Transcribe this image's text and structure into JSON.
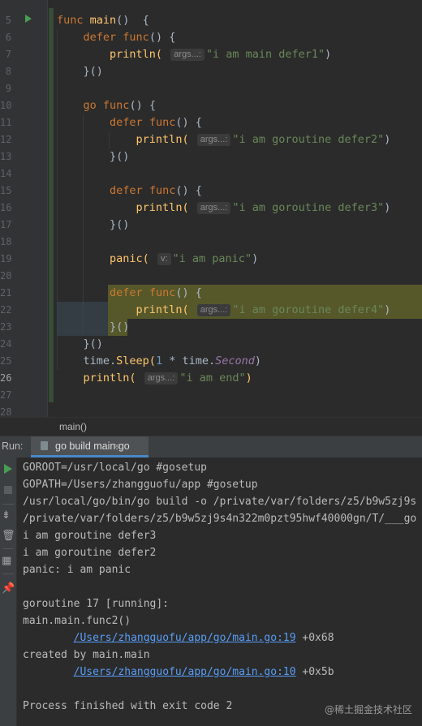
{
  "editor": {
    "line_numbers": [
      "5",
      "6",
      "7",
      "8",
      "9",
      "10",
      "11",
      "12",
      "13",
      "14",
      "15",
      "16",
      "17",
      "18",
      "19",
      "20",
      "21",
      "22",
      "23",
      "24",
      "25",
      "26",
      "27",
      "28"
    ],
    "current_line": "26",
    "code": {
      "l5": {
        "kw": "func",
        "fn": "main",
        "rest": "()  {"
      },
      "l6": {
        "kw": "defer",
        "kw2": "func",
        "rest": "() {"
      },
      "l7": {
        "call": "println(",
        "hint": "args...:",
        "str": "\"i am main defer1\"",
        "close": ")"
      },
      "l8": {
        "rest": "}()"
      },
      "l10": {
        "kw": "go",
        "kw2": "func",
        "rest": "() {"
      },
      "l11": {
        "kw": "defer",
        "kw2": "func",
        "rest": "() {"
      },
      "l12": {
        "call": "println(",
        "hint": "args...:",
        "str": "\"i am goroutine defer2\"",
        "close": ")"
      },
      "l13": {
        "rest": "}()"
      },
      "l15": {
        "kw": "defer",
        "kw2": "func",
        "rest": "() {"
      },
      "l16": {
        "call": "println(",
        "hint": "args...:",
        "str": "\"i am goroutine defer3\"",
        "close": ")"
      },
      "l17": {
        "rest": "}()"
      },
      "l19": {
        "call": "panic(",
        "hint": "v:",
        "str": "\"i am panic\"",
        "close": ")"
      },
      "l21": {
        "kw": "defer",
        "kw2": "func",
        "rest": "() {"
      },
      "l22": {
        "call": "println(",
        "hint": "args...:",
        "str": "\"i am goroutine defer4\"",
        "close": ")"
      },
      "l23": {
        "rest": "}()"
      },
      "l24": {
        "rest": "}()"
      },
      "l25": {
        "pkg": "time",
        "dot": ".",
        "method": "Sleep(",
        "num": "1",
        "op": " * ",
        "pkg2": "time",
        "dot2": ".",
        "const": "Second",
        "close": ")"
      },
      "l26": {
        "call": "println(",
        "hint": "args...:",
        "str": "\"i am end\"",
        "close": ")"
      }
    }
  },
  "breadcrumb": {
    "item": "main()"
  },
  "run_panel": {
    "label": "Run:",
    "tab": "go build main.go",
    "tab_close": "×"
  },
  "console": {
    "lines": [
      "GOROOT=/usr/local/go #gosetup",
      "GOPATH=/Users/zhangguofu/app #gosetup",
      "/usr/local/go/bin/go build -o /private/var/folders/z5/b9w5zj9s",
      "/private/var/folders/z5/b9w5zj9s4n322m0pzt95hwf40000gn/T/___go",
      "i am goroutine defer3",
      "i am goroutine defer2",
      "panic: i am panic",
      "",
      "goroutine 17 [running]:",
      "main.main.func2()"
    ],
    "trace1_link": "/Users/zhangguofu/app/go/main.go:19",
    "trace1_offset": " +0x68",
    "created_by": "created by main.main",
    "trace2_link": "/Users/zhangguofu/app/go/main.go:10",
    "trace2_offset": " +0x5b",
    "exit": "Process finished with exit code 2"
  },
  "watermark": "@稀土掘金技术社区",
  "colors": {
    "keyword": "#cc7832",
    "function": "#ffc66d",
    "string": "#6a8759",
    "number": "#6897bb",
    "constant": "#9876aa",
    "link": "#589df6",
    "highlight": "#56582a"
  }
}
